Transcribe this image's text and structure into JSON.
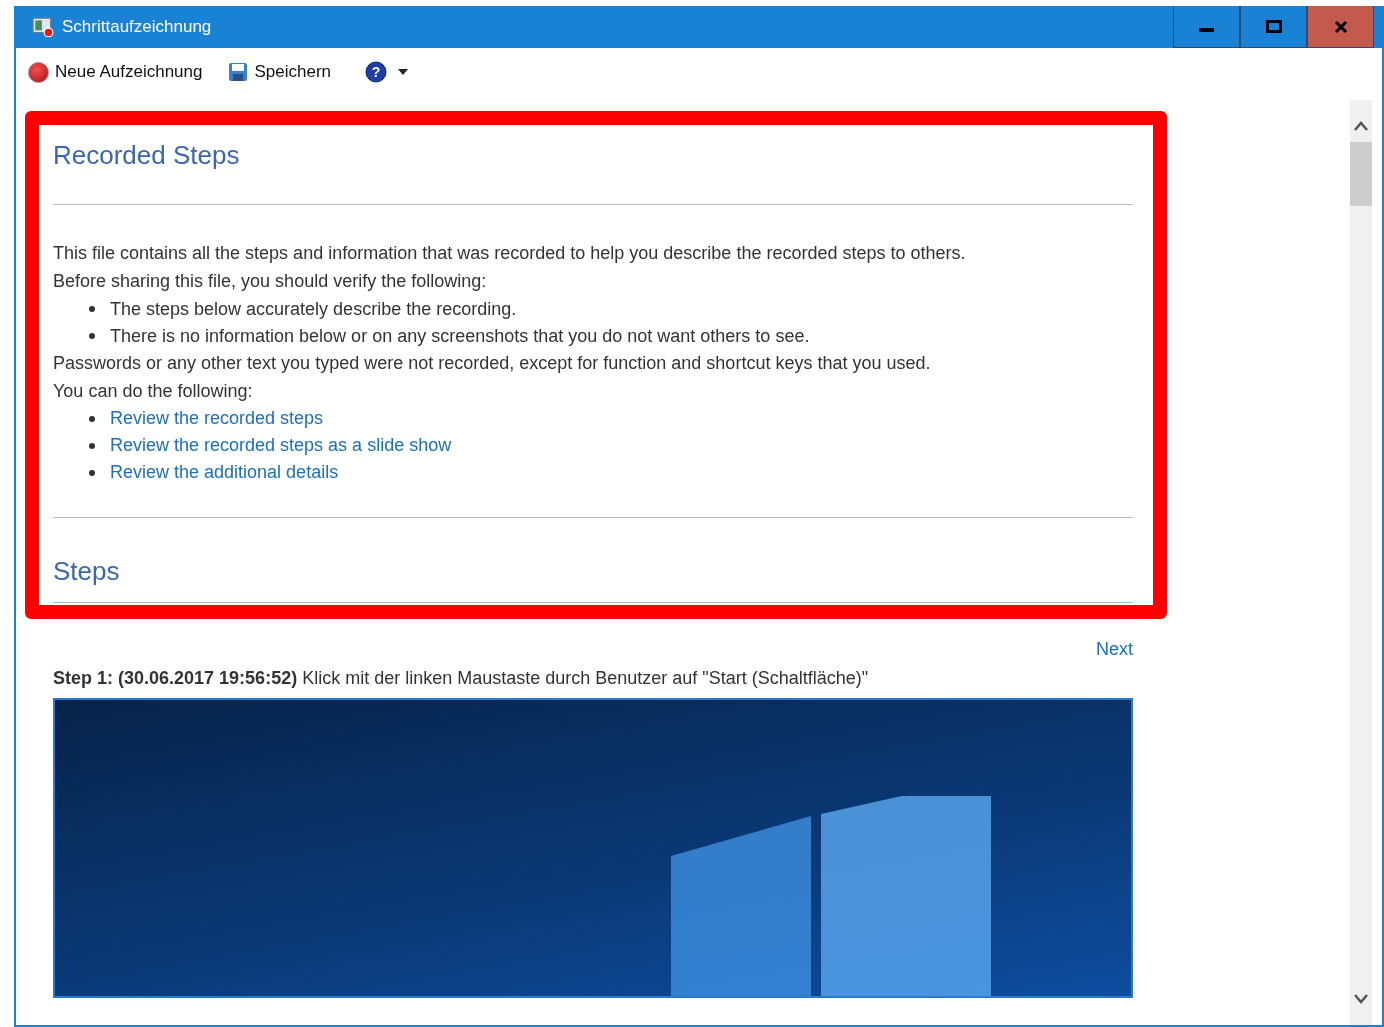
{
  "window": {
    "title": "Schrittaufzeichnung"
  },
  "toolbar": [
    {
      "kind": "record",
      "label": "Neue Aufzeichnung"
    },
    {
      "kind": "save",
      "label": "Speichern"
    },
    {
      "kind": "help",
      "label": "?"
    }
  ],
  "document": {
    "title": "Recorded Steps",
    "intro": [
      "This file contains all the steps and information that was recorded to help you describe the recorded steps to others.",
      "Before sharing this file, you should verify the following:"
    ],
    "verify_items": [
      "The steps below accurately describe the recording.",
      "There is no information below or on any screenshots that you do not want others to see."
    ],
    "notes": [
      "Passwords or any other text you typed were not recorded, except for function and shortcut keys that you used.",
      "You can do the following:"
    ],
    "links": [
      "Review the recorded steps",
      "Review the recorded steps as a slide show",
      "Review the additional details"
    ],
    "steps_heading": "Steps",
    "next_link": "Next",
    "steps": [
      {
        "caption": "**Step 1: (30.06.2017 19:56:52)** Klick mit der linken Maustaste durch Benutzer auf \"Start (Schaltfläche)\""
      }
    ]
  }
}
